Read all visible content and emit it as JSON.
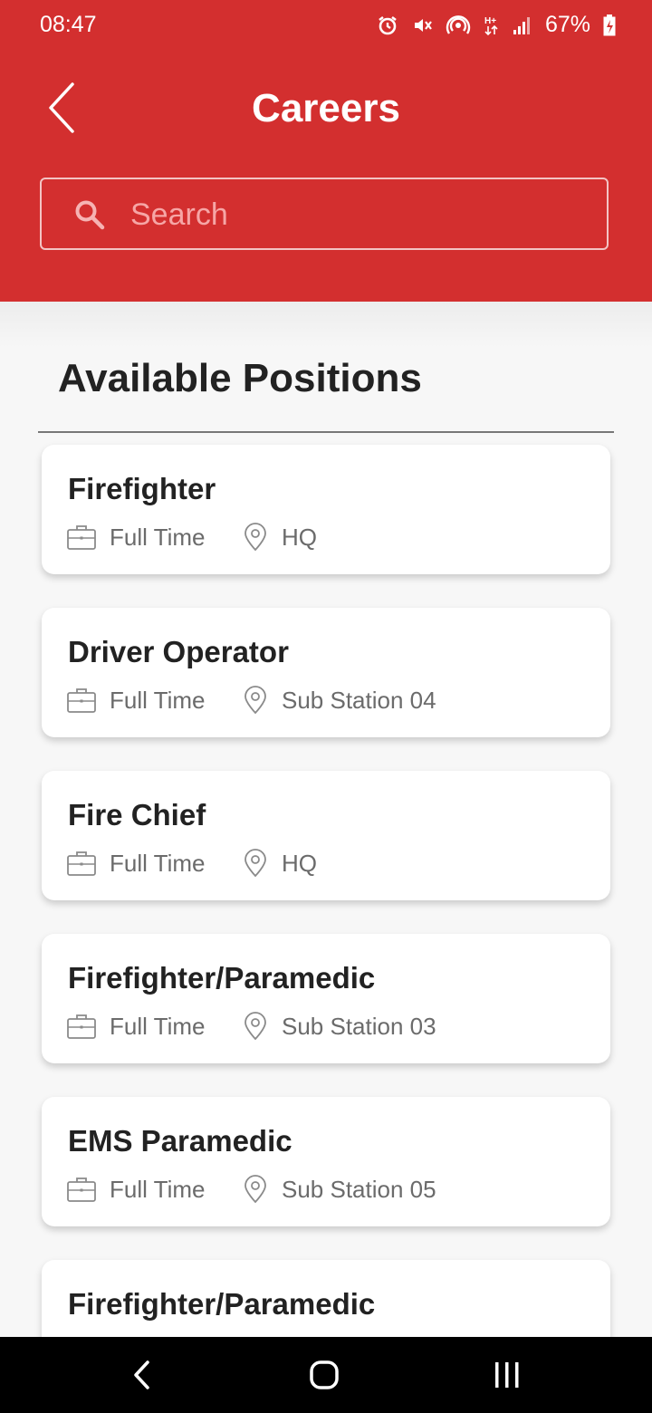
{
  "status_bar": {
    "time": "08:47",
    "battery": "67%",
    "icons": [
      "alarm-icon",
      "mute-vibrate-icon",
      "hotspot-icon",
      "hplus-data-icon",
      "signal-icon",
      "battery-charging-icon"
    ]
  },
  "header": {
    "title": "Careers",
    "back_icon": "chevron-left-icon",
    "background_color": "#d32f2f"
  },
  "search": {
    "placeholder": "Search",
    "value": "",
    "icon": "search-icon"
  },
  "section": {
    "title": "Available Positions"
  },
  "jobs": [
    {
      "title": "Firefighter",
      "type": "Full Time",
      "location": "HQ"
    },
    {
      "title": "Driver Operator",
      "type": "Full Time",
      "location": "Sub Station 04"
    },
    {
      "title": "Fire Chief",
      "type": "Full Time",
      "location": "HQ"
    },
    {
      "title": "Firefighter/Paramedic",
      "type": "Full Time",
      "location": "Sub Station 03"
    },
    {
      "title": "EMS Paramedic",
      "type": "Full Time",
      "location": "Sub Station 05"
    },
    {
      "title": "Firefighter/Paramedic",
      "type": "",
      "location": ""
    }
  ],
  "nav_bar": {
    "icons": [
      "back-nav-icon",
      "home-nav-icon",
      "recents-nav-icon"
    ]
  }
}
